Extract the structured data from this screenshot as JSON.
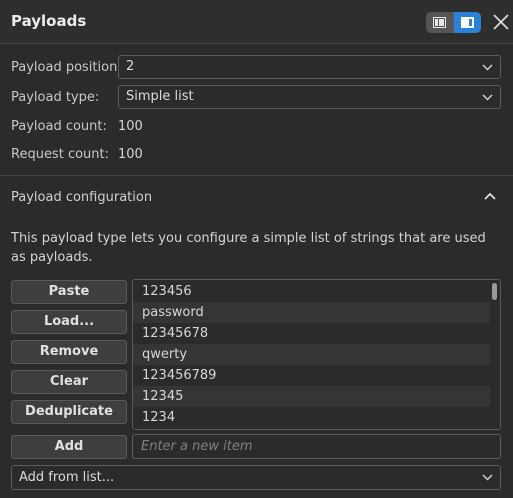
{
  "header": {
    "title": "Payloads",
    "layout_toggle": [
      "list-layout-icon",
      "panel-layout-icon"
    ],
    "accent_color": "#2a82d8"
  },
  "fields": {
    "position_label": "Payload position:",
    "position_value": "2",
    "type_label": "Payload type:",
    "type_value": "Simple list",
    "count_label": "Payload count:",
    "count_value": "100",
    "request_label": "Request count:",
    "request_value": "100"
  },
  "config": {
    "title": "Payload configuration",
    "description": "This payload type lets you configure a simple list of strings that are used as payloads."
  },
  "buttons": {
    "paste": "Paste",
    "load": "Load...",
    "remove": "Remove",
    "clear": "Clear",
    "deduplicate": "Deduplicate",
    "add": "Add"
  },
  "list": {
    "items": [
      "123456",
      "password",
      "12345678",
      "qwerty",
      "123456789",
      "12345",
      "1234"
    ]
  },
  "new_item": {
    "placeholder": "Enter a new item"
  },
  "add_from_list": {
    "value": "Add from list..."
  }
}
